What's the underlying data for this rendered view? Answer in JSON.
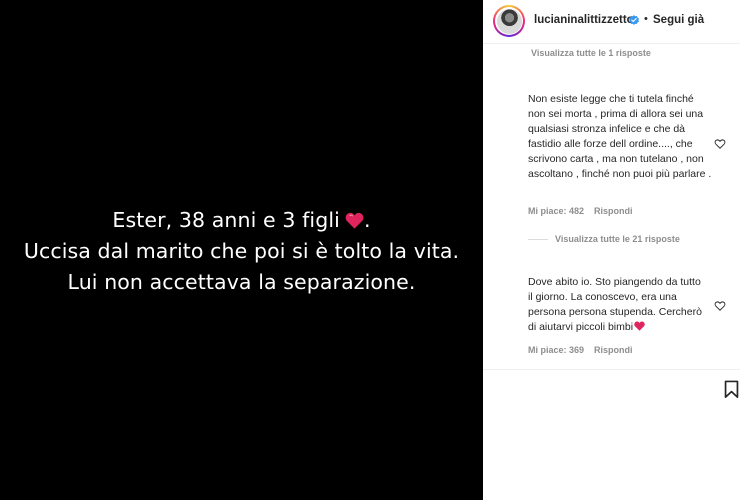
{
  "post": {
    "line1": "Ester, 38 anni e 3 figli",
    "line1_end": ".",
    "line2": "Uccisa dal marito che poi si è tolto la vita.",
    "line3": "Lui non accettava la separazione."
  },
  "header": {
    "username": "lucianinalittizzetto",
    "separator": "•",
    "follow_label": "Segui già"
  },
  "comments": {
    "thread1_view_replies": "Visualizza tutte le 1 risposte",
    "items": [
      {
        "text": "Non esiste legge che ti tutela finché non sei morta , prima di allora sei una qualsiasi stronza infelice e che dà fastidio alle forze dell ordine...., che scrivono carta , ma non tutelano , non ascoltano , finché non puoi più parlare .",
        "likes": "Mi piace: 482",
        "reply_label": "Rispondi",
        "view_replies": "Visualizza tutte le 21 risposte"
      },
      {
        "text": "Dove abito io. Sto piangendo da tutto il giorno. La conoscevo, era una persona persona stupenda. Cercherò di aiutarvi piccoli bimbi",
        "likes": "Mi piace: 369",
        "reply_label": "Rispondi"
      }
    ]
  },
  "colors": {
    "media_bg": "#000000",
    "verified_blue": "#3897f0",
    "emoji_heart": "#e0245e",
    "muted_text": "#8e8e8e"
  },
  "icons": [
    "verified-icon",
    "heart-emoji-icon",
    "like-heart-icon",
    "bookmark-icon"
  ]
}
